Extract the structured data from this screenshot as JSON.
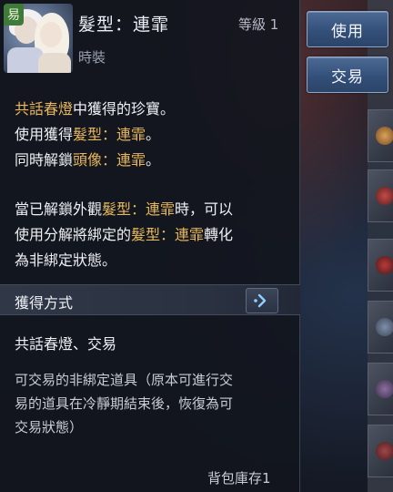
{
  "item": {
    "trade_tag": "易",
    "name": "髮型：連霏",
    "type": "時裝",
    "level": "等級 1"
  },
  "description": {
    "line1": {
      "event": "共話春燈",
      "rest": "中獲得的珍寶。"
    },
    "line2": {
      "prefix": "使用獲得",
      "item": "髮型：連霏",
      "suffix": "。"
    },
    "line3": {
      "prefix": "同時解鎖",
      "item": "頭像：連霏",
      "suffix": "。"
    },
    "line4": {
      "prefix": "當已解鎖外觀",
      "item": "髮型：連霏",
      "suffix": "時，可以"
    },
    "line5": {
      "prefix": "使用分解將綁定的",
      "item": "髮型：連霏",
      "suffix": "轉化"
    },
    "line6": {
      "text": "為非綁定狀態。"
    }
  },
  "acquire": {
    "title": "獲得方式",
    "sources": "共話春燈、交易"
  },
  "trade_note": {
    "line1": "可交易的非綁定道具（原本可進行交",
    "line2": "易的道具在冷靜期結束後，恢復為可",
    "line3": "交易狀態）"
  },
  "stock": "背包庫存1",
  "buttons": {
    "use": "使用",
    "trade": "交易"
  },
  "colors": {
    "highlight": "#e8b85a",
    "button": "#33507a"
  }
}
